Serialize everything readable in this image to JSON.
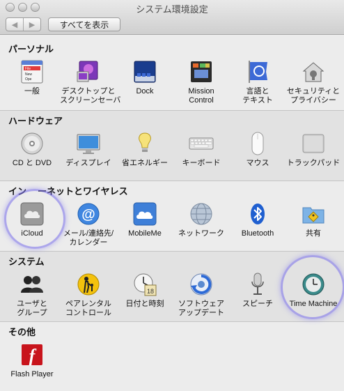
{
  "window": {
    "title": "システム環境設定",
    "show_all": "すべてを表示",
    "back": "◀",
    "forward": "▶"
  },
  "sections": {
    "personal": {
      "title": "パーソナル",
      "items": [
        {
          "line1": "一般",
          "line2": "",
          "icon": "general-icon"
        },
        {
          "line1": "デスクトップと",
          "line2": "スクリーンセーバ",
          "icon": "desktop-screensaver-icon"
        },
        {
          "line1": "Dock",
          "line2": "",
          "icon": "dock-icon"
        },
        {
          "line1": "Mission",
          "line2": "Control",
          "icon": "mission-control-icon"
        },
        {
          "line1": "言語と",
          "line2": "テキスト",
          "icon": "language-flag-icon"
        },
        {
          "line1": "セキュリティと",
          "line2": "プライバシー",
          "icon": "security-house-icon"
        }
      ]
    },
    "hardware": {
      "title": "ハードウェア",
      "items": [
        {
          "line1": "CD と DVD",
          "line2": "",
          "icon": "cd-dvd-icon"
        },
        {
          "line1": "ディスプレイ",
          "line2": "",
          "icon": "display-icon"
        },
        {
          "line1": "省エネルギー",
          "line2": "",
          "icon": "energy-bulb-icon"
        },
        {
          "line1": "キーボード",
          "line2": "",
          "icon": "keyboard-icon"
        },
        {
          "line1": "マウス",
          "line2": "",
          "icon": "mouse-icon"
        },
        {
          "line1": "トラックパッド",
          "line2": "",
          "icon": "trackpad-icon"
        }
      ]
    },
    "internet": {
      "title_a": "イン",
      "title_b": "ーネットとワイヤレス",
      "items": [
        {
          "line1": "iCloud",
          "line2": "",
          "icon": "icloud-icon"
        },
        {
          "line1": "メール/連絡先/",
          "line2": "カレンダー",
          "icon": "mail-at-icon"
        },
        {
          "line1": "MobileMe",
          "line2": "",
          "icon": "mobileme-cloud-icon"
        },
        {
          "line1": "ネットワーク",
          "line2": "",
          "icon": "network-globe-icon"
        },
        {
          "line1": "Bluetooth",
          "line2": "",
          "icon": "bluetooth-icon"
        },
        {
          "line1": "共有",
          "line2": "",
          "icon": "sharing-folder-icon"
        }
      ]
    },
    "system": {
      "title": "システム",
      "items": [
        {
          "line1": "ユーザと",
          "line2": "グループ",
          "icon": "users-groups-icon"
        },
        {
          "line1": "ペアレンタル",
          "line2": "コントロール",
          "icon": "parental-controls-icon"
        },
        {
          "line1": "日付と時刻",
          "line2": "",
          "icon": "date-time-icon"
        },
        {
          "line1": "ソフトウェア",
          "line2": "アップデート",
          "icon": "software-update-icon"
        },
        {
          "line1": "スピーチ",
          "line2": "",
          "icon": "speech-microphone-icon"
        },
        {
          "line1": "Time Machine",
          "line2": "",
          "icon": "time-machine-icon"
        }
      ]
    },
    "other": {
      "title": "その他",
      "items": [
        {
          "line1": "Flash Player",
          "line2": "",
          "icon": "flash-player-icon"
        }
      ]
    }
  },
  "general_icon_text": {
    "a": "File",
    "b": "New",
    "c": "Ope"
  },
  "date_icon_text": {
    "day": "18"
  },
  "flash_icon_text": {
    "letter": "f"
  },
  "colors": {
    "window_bg": "#ececec",
    "alt_band": "#e2e2e2",
    "highlight": "#786eeb"
  }
}
